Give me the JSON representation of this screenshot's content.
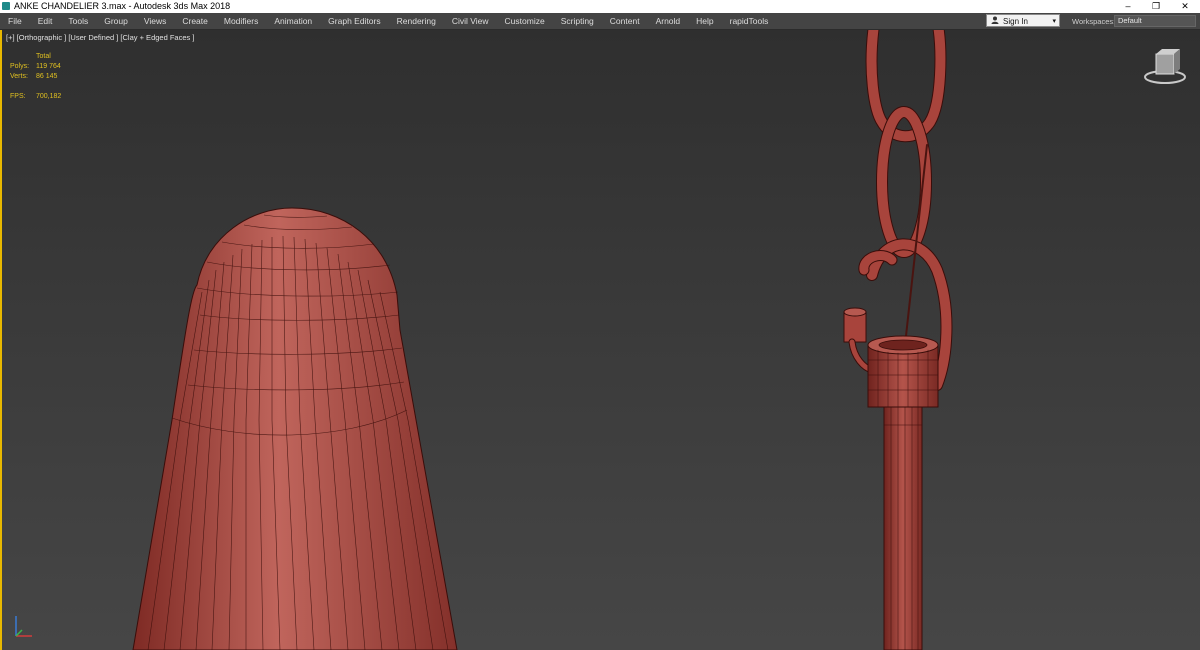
{
  "window": {
    "title": "ANKE CHANDELIER 3.max - Autodesk 3ds Max 2018",
    "minimize": "–",
    "restore": "❐",
    "close": "✕"
  },
  "menu": [
    "File",
    "Edit",
    "Tools",
    "Group",
    "Views",
    "Create",
    "Modifiers",
    "Animation",
    "Graph Editors",
    "Rendering",
    "Civil View",
    "Customize",
    "Scripting",
    "Content",
    "Arnold",
    "Help",
    "rapidTools"
  ],
  "account": {
    "sign_in": "Sign In",
    "caret": "▾"
  },
  "workspaces": {
    "label": "Workspaces:",
    "value": "Default"
  },
  "viewport": {
    "label": "[+] [Orthographic ] [User Defined ] [Clay + Edged Faces ]",
    "stats": {
      "header": "Total",
      "polys_label": "Polys:",
      "polys_value": "119 764",
      "verts_label": "Verts:",
      "verts_value": "86 145",
      "fps_label": "FPS:",
      "fps_value": "700,182"
    }
  },
  "colors": {
    "model_fill": "#a8443c",
    "model_wire": "#3a0d0a",
    "viewport_border": "#e8b800",
    "stats_text": "#e0c020"
  }
}
